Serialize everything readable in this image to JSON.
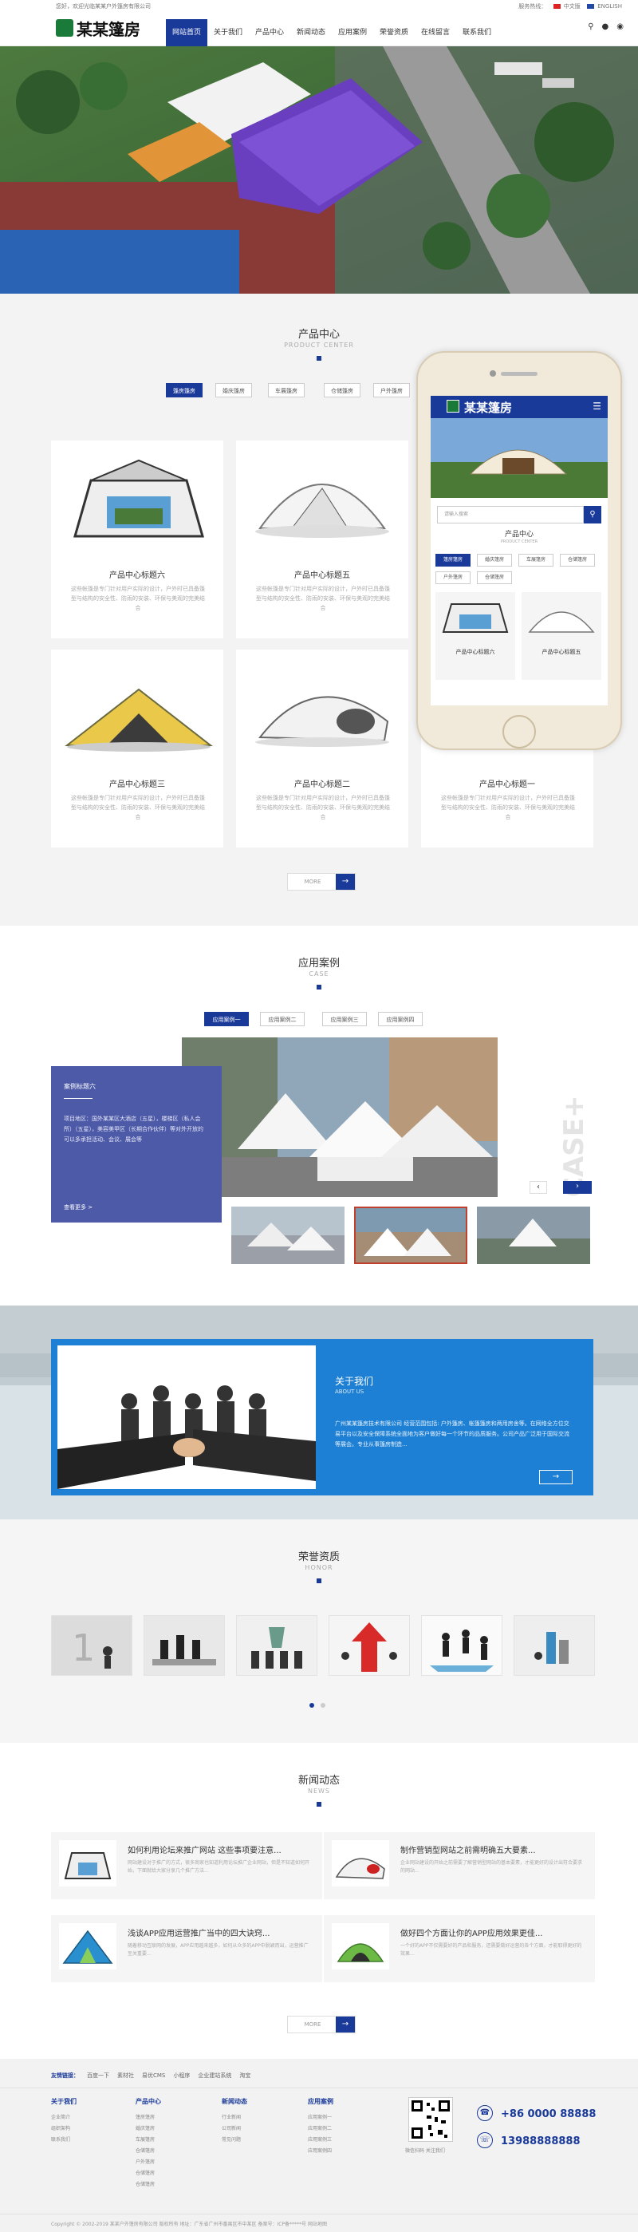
{
  "topbar": {
    "welcome": "您好，欢迎光临某某户外篷房有限公司",
    "tel_label": "服务热线：",
    "lang_cn": "中文版",
    "lang_en": "ENGLISH"
  },
  "header": {
    "logo_text": "某某篷房",
    "nav": [
      "网站首页",
      "关于我们",
      "产品中心",
      "新闻动态",
      "应用案例",
      "荣誉资质",
      "在线留言",
      "联系我们"
    ],
    "active": 0
  },
  "products": {
    "title": "产品中心",
    "subtitle": "PRODUCT CENTER",
    "tabs": [
      "篷房篷房",
      "婚庆篷房",
      "车展篷房",
      "仓储篷房",
      "户外篷房"
    ],
    "items": [
      {
        "title": "产品中心标题六",
        "desc": "这些帐篷是专门针对用户实际的设计，户外时已具备篷型与结构的安全性、防雨的安装、环保与美观的完美结合"
      },
      {
        "title": "产品中心标题五",
        "desc": "这些帐篷是专门针对用户实际的设计，户外时已具备篷型与结构的安全性、防雨的安装、环保与美观的完美结合"
      },
      {
        "title": "",
        "desc": ""
      },
      {
        "title": "产品中心标题三",
        "desc": "这些帐篷是专门针对用户实际的设计，户外时已具备篷型与结构的安全性、防雨的安装、环保与美观的完美结合"
      },
      {
        "title": "产品中心标题二",
        "desc": "这些帐篷是专门针对用户实际的设计，户外时已具备篷型与结构的安全性、防雨的安装、环保与美观的完美结合"
      },
      {
        "title": "产品中心标题一",
        "desc": "这些帐篷是专门针对用户实际的设计，户外时已具备篷型与结构的安全性、防雨的安装、环保与美观的完美结合"
      }
    ],
    "more": "MORE"
  },
  "phone": {
    "logo_text": "某某篷房",
    "search_placeholder": "请输入搜索",
    "title": "产品中心",
    "subtitle": "PRODUCT CENTER",
    "tabs": [
      "篷房篷房",
      "婚庆篷房",
      "车展篷房",
      "仓储篷房",
      "户外篷房",
      "仓储篷房"
    ],
    "items": [
      "产品中心标题六",
      "产品中心标题五"
    ]
  },
  "cases": {
    "title": "应用案例",
    "subtitle": "CASE",
    "tabs": [
      "应用案例一",
      "应用案例二",
      "应用案例三",
      "应用案例四"
    ],
    "feature_title": "案例标题六",
    "feature_desc": "项目地区：国外某某区大酒店（五星），楼梯区（私人会所）（五星），美容美甲区（长期合作伙伴）等对外开放的可以多承担活动、会议、展会等",
    "feature_more": "查看更多 >",
    "watermark": "CASE+"
  },
  "about": {
    "title": "关于我们",
    "subtitle": "ABOUT US",
    "desc": "广州某某篷房技术有限公司 经营范围包括: 户外篷房、帐篷篷房和两用房舍等。在网络全方位交易平台以及安全保障系统全面地为客户做好每一个环节的品质服务。公司产品广泛用于国际交流等展会。专业从事篷房制造..."
  },
  "honor": {
    "title": "荣誉资质",
    "subtitle": "HONOR"
  },
  "news": {
    "title": "新闻动态",
    "subtitle": "NEWS",
    "items": [
      {
        "title": "如何利用论坛来推广网站 这些事项要注意...",
        "desc": "网站建设对于推广的方式，很多商家也知道利用论坛推广企业网站，但是不知道如何开始，下面就给大家分享几个推广方法..."
      },
      {
        "title": "制作营销型网站之前需明确五大要素...",
        "desc": "企业网站建设的开始之前需要了解营销型网站的基本要素，才能更好的设计出符合要求的网站..."
      },
      {
        "title": "浅谈APP应用运营推广当中的四大诀窍...",
        "desc": "随着移动互联网的发展，APP应用越来越多，如何从众多的APP中脱颖而出，运营推广至关重要..."
      },
      {
        "title": "做好四个方面让你的APP应用效果更佳...",
        "desc": "一个好的APP不仅需要好的产品和服务，还需要做好运营的各个方面，才能取得更好的效果..."
      }
    ],
    "more": "MORE"
  },
  "footer": {
    "links_label": "友情链接：",
    "links": [
      "百度一下",
      "素材社",
      "易优CMS",
      "小程序",
      "企业建站系统",
      "淘宝"
    ],
    "cols": [
      {
        "title": "关于我们",
        "items": [
          "企业简介",
          "组织架构",
          "联系我们"
        ]
      },
      {
        "title": "产品中心",
        "items": [
          "篷房篷房",
          "婚庆篷房",
          "车展篷房",
          "仓储篷房",
          "户外篷房",
          "仓储篷房",
          "仓储篷房"
        ]
      },
      {
        "title": "新闻动态",
        "items": [
          "行业新闻",
          "公司新闻",
          "常见问题"
        ]
      },
      {
        "title": "应用案例",
        "items": [
          "应用案例一",
          "应用案例二",
          "应用案例三",
          "应用案例四"
        ]
      }
    ],
    "qr_caption": "微信扫码 关注我们",
    "phone1": "+86 0000 88888",
    "phone2": "13988888888",
    "copyright": "Copyright © 2002-2019 某某户外篷房有限公司 版权所有   地址：广东省广州市番禺区市中某区   备案号：ICP备*****号   网站地图"
  }
}
